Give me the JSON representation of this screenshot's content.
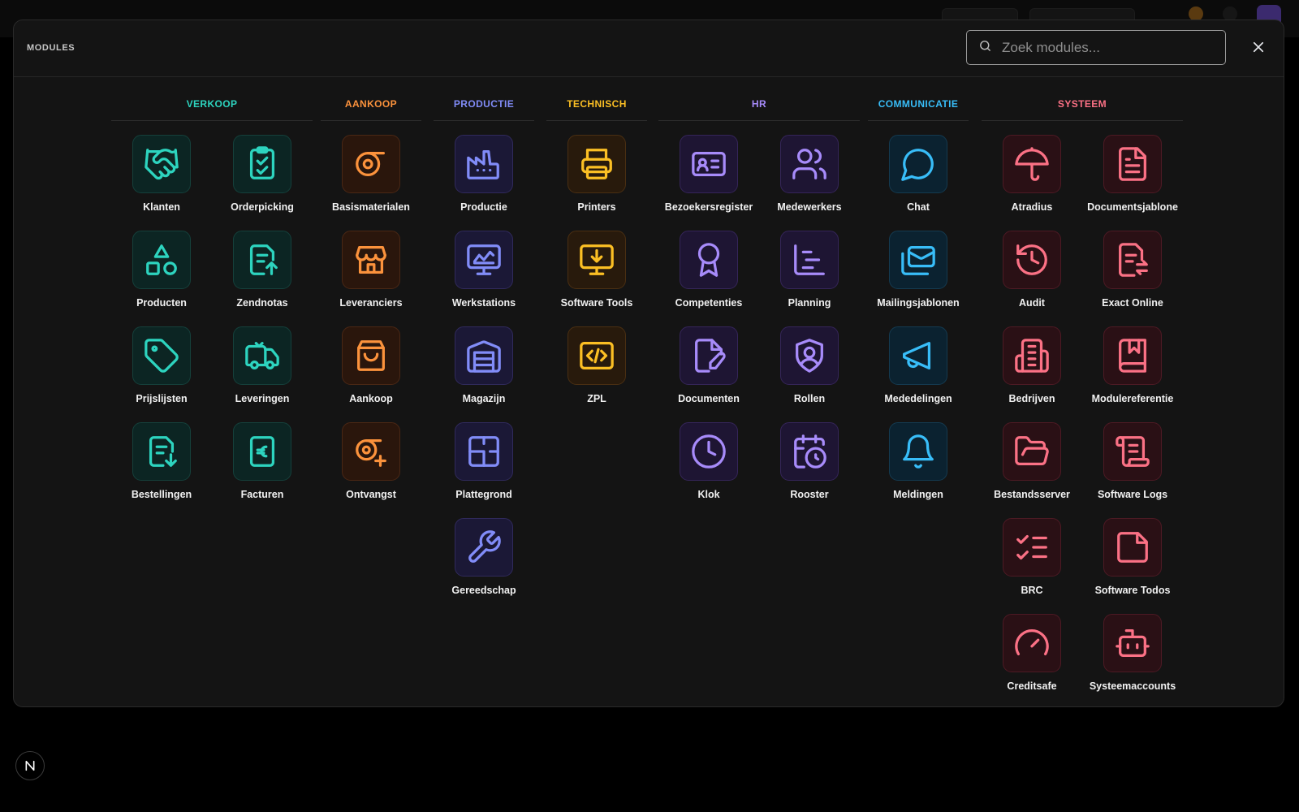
{
  "panel": {
    "title": "MODULES"
  },
  "search": {
    "placeholder": "Zoek modules..."
  },
  "colors": {
    "verkoop": "#2dd4bf",
    "aankoop": "#fb923c",
    "productie": "#818cf8",
    "technisch": "#fbbf24",
    "hr": "#a78bfa",
    "communicatie": "#38bdf8",
    "systeem": "#fb7185"
  },
  "groups": {
    "verkoop": {
      "title": "VERKOOP",
      "modules": [
        {
          "label": "Klanten",
          "icon": "handshake-icon"
        },
        {
          "label": "Orderpicking",
          "icon": "clipboard-check-icon"
        },
        {
          "label": "Producten",
          "icon": "shapes-icon"
        },
        {
          "label": "Zendnotas",
          "icon": "file-upload-icon"
        },
        {
          "label": "Prijslijsten",
          "icon": "tags-icon"
        },
        {
          "label": "Leveringen",
          "icon": "delivery-truck-icon"
        },
        {
          "label": "Bestellingen",
          "icon": "file-download-icon"
        },
        {
          "label": "Facturen",
          "icon": "euro-receipt-icon"
        }
      ]
    },
    "aankoop": {
      "title": "AANKOOP",
      "modules": [
        {
          "label": "Basismaterialen",
          "icon": "material-roll-icon"
        },
        {
          "label": "Leveranciers",
          "icon": "store-icon"
        },
        {
          "label": "Aankoop",
          "icon": "shopping-bag-icon"
        },
        {
          "label": "Ontvangst",
          "icon": "roll-plus-icon"
        }
      ]
    },
    "productie": {
      "title": "PRODUCTIE",
      "modules": [
        {
          "label": "Productie",
          "icon": "factory-icon"
        },
        {
          "label": "Werkstations",
          "icon": "monitor-chart-icon"
        },
        {
          "label": "Magazijn",
          "icon": "warehouse-icon"
        },
        {
          "label": "Plattegrond",
          "icon": "floorplan-icon"
        },
        {
          "label": "Gereedschap",
          "icon": "wrench-icon"
        }
      ]
    },
    "technisch": {
      "title": "TECHNISCH",
      "modules": [
        {
          "label": "Printers",
          "icon": "printer-icon"
        },
        {
          "label": "Software Tools",
          "icon": "monitor-download-icon"
        },
        {
          "label": "ZPL",
          "icon": "code-icon"
        }
      ]
    },
    "hr": {
      "title": "HR",
      "modules": [
        {
          "label": "Bezoekersregister",
          "icon": "id-card-icon"
        },
        {
          "label": "Medewerkers",
          "icon": "users-icon"
        },
        {
          "label": "Competenties",
          "icon": "award-icon"
        },
        {
          "label": "Planning",
          "icon": "gantt-chart-icon"
        },
        {
          "label": "Documenten",
          "icon": "file-edit-icon"
        },
        {
          "label": "Rollen",
          "icon": "shield-user-icon"
        },
        {
          "label": "Klok",
          "icon": "clock-icon"
        },
        {
          "label": "Rooster",
          "icon": "calendar-clock-icon"
        }
      ]
    },
    "communicatie": {
      "title": "COMMUNICATIE",
      "modules": [
        {
          "label": "Chat",
          "icon": "message-circle-icon"
        },
        {
          "label": "Mailingsjablonen",
          "icon": "mails-icon"
        },
        {
          "label": "Mededelingen",
          "icon": "megaphone-icon"
        },
        {
          "label": "Meldingen",
          "icon": "bell-icon"
        }
      ]
    },
    "systeem": {
      "title": "SYSTEEM",
      "modules": [
        {
          "label": "Atradius",
          "icon": "umbrella-icon"
        },
        {
          "label": "Documentsjablone",
          "icon": "file-text-icon"
        },
        {
          "label": "Audit",
          "icon": "history-icon"
        },
        {
          "label": "Exact Online",
          "icon": "file-swap-icon"
        },
        {
          "label": "Bedrijven",
          "icon": "building-icon"
        },
        {
          "label": "Modulereferentie",
          "icon": "book-marked-icon"
        },
        {
          "label": "Bestandsserver",
          "icon": "folder-open-icon"
        },
        {
          "label": "Software Logs",
          "icon": "scroll-text-icon"
        },
        {
          "label": "BRC",
          "icon": "list-checks-icon"
        },
        {
          "label": "Software Todos",
          "icon": "sticky-note-icon"
        },
        {
          "label": "Creditsafe",
          "icon": "gauge-icon"
        },
        {
          "label": "Systeemaccounts",
          "icon": "bot-icon"
        }
      ]
    }
  },
  "footer": {
    "badge": "N"
  }
}
